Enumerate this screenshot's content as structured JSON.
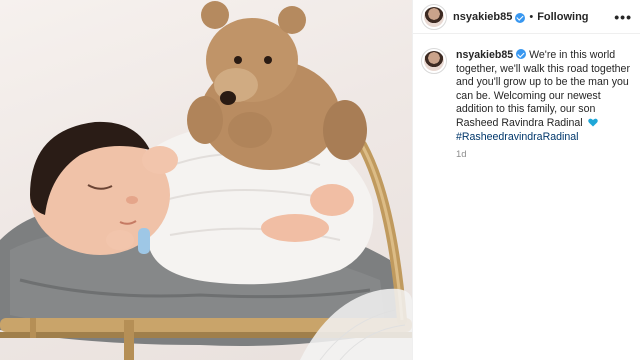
{
  "post": {
    "username": "nsyakieb85",
    "follow_label": "Following",
    "separator": "•",
    "more_icon": "more-horizontal-icon",
    "verified_icon": "verified-badge-icon"
  },
  "caption": {
    "username": "nsyakieb85",
    "text": "We're in this world together, we'll walk this road together and you'll grow up to be the man you can be. Welcoming our newest addition to this family, our son Rasheed Ravindra Radinal",
    "emoji_icon": "blue-heart-icon",
    "hashtag": "#RasheedravindraRadinal",
    "timestamp": "1d"
  },
  "colors": {
    "verified": "#3897f0",
    "hashtag": "#00376b",
    "heart": "#1fa7d8",
    "timestamp": "#8e8e8e"
  }
}
